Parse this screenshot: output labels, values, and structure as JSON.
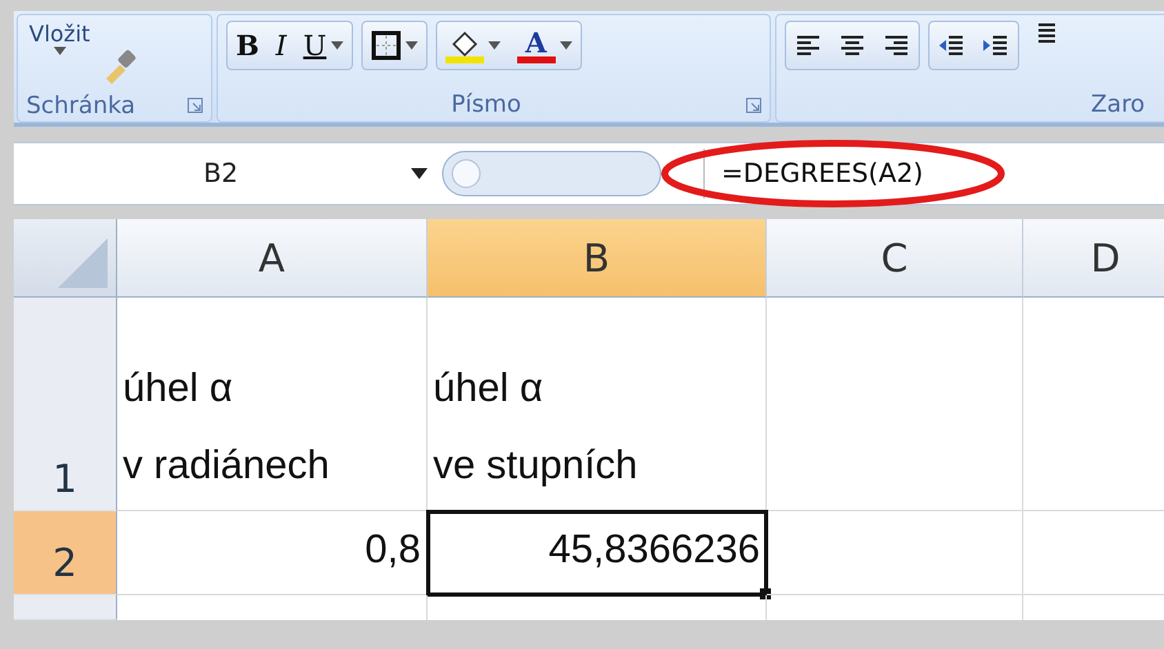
{
  "ribbon": {
    "clipboard": {
      "paste_label": "Vložit",
      "group_label": "Schránka"
    },
    "font": {
      "group_label": "Písmo",
      "buttons": [
        {
          "kind": "bold",
          "text": "B"
        },
        {
          "kind": "italic",
          "text": "I"
        },
        {
          "kind": "underline",
          "text": "U"
        },
        {
          "kind": "border"
        },
        {
          "kind": "fill",
          "color": "#f2e400"
        },
        {
          "kind": "fontcolor",
          "text": "A",
          "color": "#e01010"
        }
      ]
    },
    "alignment": {
      "group_label": "Zaro",
      "buttons": [
        {
          "kind": "left"
        },
        {
          "kind": "center"
        },
        {
          "kind": "right"
        },
        {
          "kind": "outdent"
        },
        {
          "kind": "indent"
        },
        {
          "kind": "wrap"
        }
      ]
    }
  },
  "formula_bar": {
    "name_box": "B2",
    "formula": "=DEGREES(A2)",
    "circled": true
  },
  "sheet": {
    "columns": [
      {
        "label": "A",
        "selected": false
      },
      {
        "label": "B",
        "selected": true
      },
      {
        "label": "C",
        "selected": false
      },
      {
        "label": "D",
        "selected": false
      }
    ],
    "rows": [
      {
        "label": "1",
        "selected": false,
        "cells": [
          {
            "kind": "text",
            "lines": [
              "úhel α",
              "v radiánech"
            ],
            "active": false
          },
          {
            "kind": "text",
            "lines": [
              "úhel α",
              "ve stupních"
            ],
            "active": false
          },
          {
            "kind": "empty",
            "active": false
          },
          {
            "kind": "empty",
            "active": false
          }
        ]
      },
      {
        "label": "2",
        "selected": true,
        "cells": [
          {
            "kind": "number",
            "lines": [
              "0,8"
            ],
            "active": false
          },
          {
            "kind": "number",
            "lines": [
              "45,8366236"
            ],
            "active": true
          },
          {
            "kind": "empty",
            "active": false
          },
          {
            "kind": "empty",
            "active": false
          }
        ]
      }
    ]
  }
}
